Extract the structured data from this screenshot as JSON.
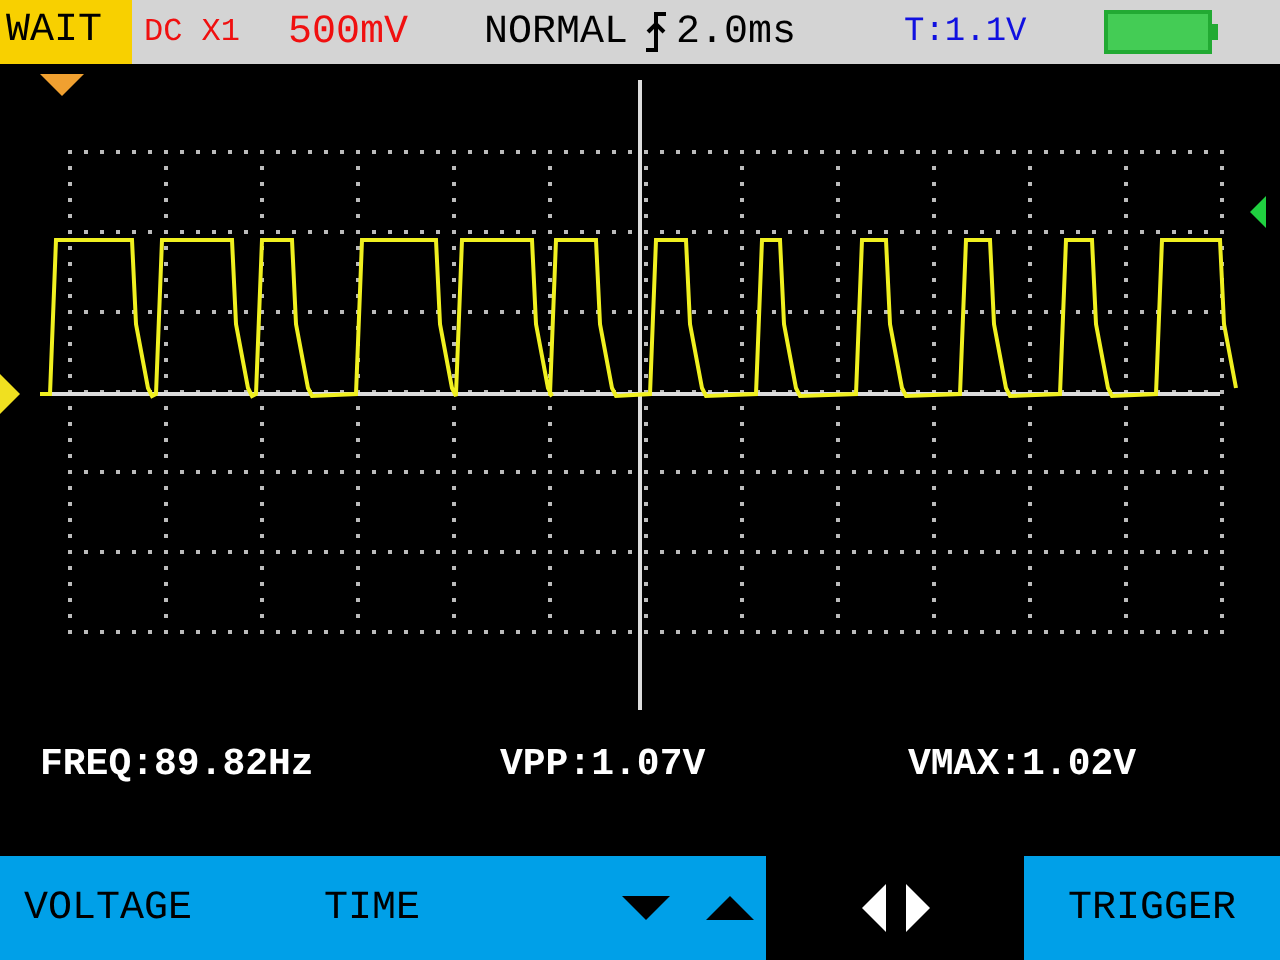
{
  "status_bar": {
    "mode": "WAIT",
    "coupling": "DC X1",
    "volts_per_div": "500mV",
    "trigger_mode": "NORMAL",
    "timebase": "2.0ms",
    "trigger_level": "T:1.1V"
  },
  "readouts": [
    "FREQ:89.82Hz",
    "VPP:1.07V",
    "VMAX:1.02V"
  ],
  "softkeys": [
    {
      "label": "VOLTAGE"
    },
    {
      "label": "TIME"
    }
  ],
  "trigger_button": {
    "label": "TRIGGER"
  }
}
